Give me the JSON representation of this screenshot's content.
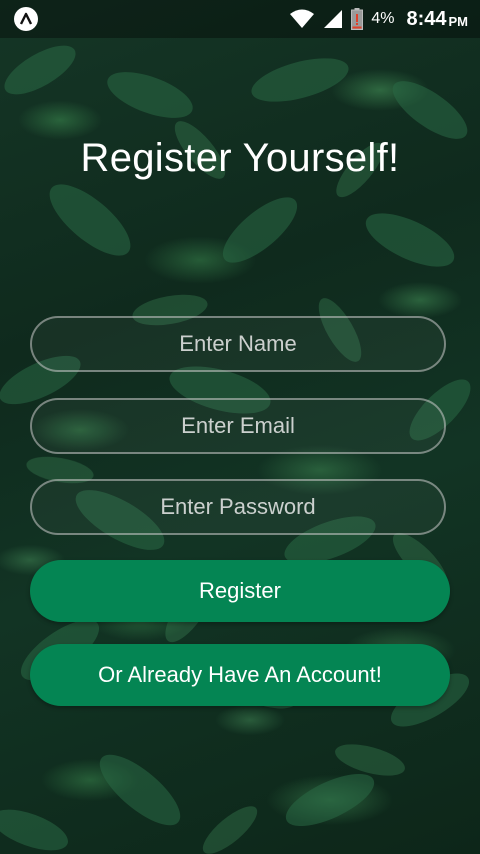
{
  "status_bar": {
    "app_icon": "app-logo-icon",
    "wifi_icon": "wifi-icon",
    "signal_icon": "cell-signal-icon",
    "battery_icon": "battery-icon",
    "battery_percent": "4%",
    "time": "8:44",
    "ampm": "PM"
  },
  "register": {
    "title": "Register Yourself!",
    "name_placeholder": "Enter Name",
    "email_placeholder": "Enter Email",
    "password_placeholder": "Enter Password",
    "register_label": "Register",
    "login_label": "Or Already Have An Account!"
  },
  "colors": {
    "button_green": "#048553",
    "text": "#ffffff",
    "field_border": "#c8c8c8"
  }
}
